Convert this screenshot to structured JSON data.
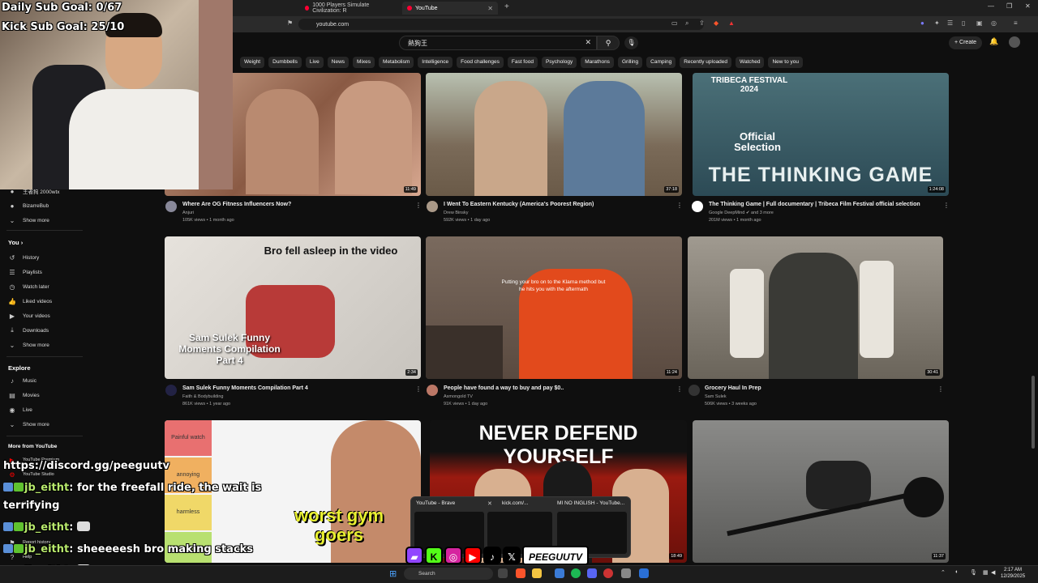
{
  "browser": {
    "tabs": [
      {
        "label": "1000 Players Simulate Civilization: R"
      },
      {
        "label": "YouTube"
      }
    ],
    "url": "youtube.com"
  },
  "youtube": {
    "search_query": "熱狗王",
    "create_label": "Create",
    "chips": [
      "Weight",
      "Dumbbells",
      "Live",
      "News",
      "Mixes",
      "Metabolism",
      "Intelligence",
      "Food challenges",
      "Fast food",
      "Psychology",
      "Marathons",
      "Grilling",
      "Camping",
      "Recently uploaded",
      "Watched",
      "New to you"
    ]
  },
  "sidebar": {
    "top_items": [
      "王者狗 2000wtx",
      "BizarreBub",
      "Show more"
    ],
    "you_heading": "You",
    "you_items": [
      "History",
      "Playlists",
      "Watch later",
      "Liked videos",
      "Your videos",
      "Downloads",
      "Show more"
    ],
    "explore_heading": "Explore",
    "explore_items": [
      "Music",
      "Movies",
      "Live",
      "Show more"
    ],
    "more_heading": "More from YouTube",
    "more_items": [
      "YouTube Premium",
      "YouTube Studio",
      "YouTube Kids",
      "Report history",
      "Help"
    ]
  },
  "videos": [
    {
      "title": "Where Are OG Fitness Influencers Now?",
      "channel": "Anjuri",
      "meta": "105K views • 1 month ago",
      "duration": "11:49",
      "overlay": "",
      "color": "#a86a50"
    },
    {
      "title": "I Went To Eastern Kentucky (America's Poorest Region)",
      "channel": "Drew Binsky",
      "meta": "592K views • 1 day ago",
      "duration": "37:18",
      "overlay": "",
      "color": "#7a6a58"
    },
    {
      "title": "The Thinking Game | Full documentary | Tribeca Film Festival official selection",
      "channel": "Google DeepMind",
      "channel_extra": "and 3 more",
      "meta": "201M views • 1 month ago",
      "duration": "1:24:08",
      "overlay": "THE THINKING GAME",
      "overlay2": "Official Selection",
      "overlay3": "TRIBECA FESTIVAL 2024",
      "color": "#2c4a55"
    },
    {
      "title": "Sam Sulek Funny Moments Compilation Part 4",
      "channel": "Faith & Bodybuilding",
      "meta": "861K views • 1 year ago",
      "duration": "2:34",
      "overlay": "Bro fell asleep in the video",
      "overlay2": "Sam Sulek Funny Moments Compilation Part 4",
      "color": "#d8d4ce"
    },
    {
      "title": "People have found a way to buy and pay $0..",
      "channel": "Asmongold TV",
      "meta": "91K views • 1 day ago",
      "duration": "11:24",
      "overlay": "Putting your bro on to the Klarna method but he hits you with the aftermath",
      "color": "#6c5a4e"
    },
    {
      "title": "Grocery Haul In Prep",
      "channel": "Sam Sulek",
      "meta": "506K views • 3 weeks ago",
      "duration": "30:41",
      "overlay": "",
      "color": "#8a8478"
    },
    {
      "title": "",
      "channel": "",
      "meta": "",
      "duration": "",
      "overlay": "worst gym goers",
      "tiers": [
        "Painful watch",
        "annoying",
        "harmless"
      ],
      "color": "#f4f4f4"
    },
    {
      "title": "",
      "channel": "",
      "meta": "",
      "duration": "18:49",
      "overlay": "NEVER DEFEND YOURSELF",
      "color": "#8e1a12"
    },
    {
      "title": "",
      "channel": "",
      "meta": "",
      "duration": "11:37",
      "overlay": "",
      "color": "#6a6a6a"
    }
  ],
  "stream": {
    "goal1": "Daily Sub Goal: 0/67",
    "goal2": "Kick Sub Goal: 25/10",
    "discord": "https://discord.gg/peeguutv",
    "chat": [
      {
        "user": "jb_eitht",
        "msg": ": for the freefall ride, the wait is"
      },
      {
        "user": "",
        "msg": "terrifying"
      },
      {
        "user": "jb_eitht",
        "msg": ":"
      },
      {
        "user": "jb_eitht",
        "msg": ": sheeeeesh bro making stacks"
      },
      {
        "user": "jb_eitht",
        "msg": ":"
      }
    ],
    "brand": "PEEGUUTV"
  },
  "taskbar_popup": [
    "YouTube - Brave",
    "kick.com/...",
    "MI NO INGLISH - YouTube..."
  ],
  "taskbar": {
    "search": "Search",
    "time": "2:17 AM",
    "date": "12/29/2025"
  }
}
